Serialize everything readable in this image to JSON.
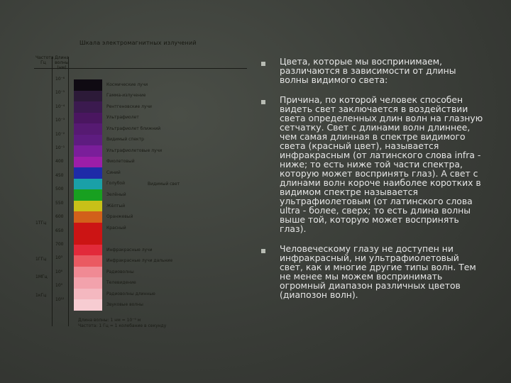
{
  "figure": {
    "title": "Шкала электромагнитных излучений",
    "head_a": "Частота Гц",
    "head_b": "Длина волны (нм)",
    "bands": [
      {
        "color": "#0f0a12",
        "label": "Космические лучи"
      },
      {
        "color": "#2c1a38",
        "label": "Гамма-излучение"
      },
      {
        "color": "#3b1a4f",
        "label": "Рентгеновские лучи"
      },
      {
        "color": "#4a1660",
        "label": "Ультрафиолет"
      },
      {
        "color": "#561a72",
        "label": "Ультрафиолет ближний"
      },
      {
        "color": "#5e1c80",
        "label": "Видимый спектр"
      },
      {
        "color": "#7a1e9a",
        "label": "Ультрафиолетовые лучи"
      },
      {
        "color": "#9c1ea8",
        "label": "Фиолетовый"
      },
      {
        "color": "#1e2ba8",
        "label": "Синий"
      },
      {
        "color": "#1aa0a8",
        "label": "Голубой"
      },
      {
        "color": "#18a020",
        "label": "Зелёный"
      },
      {
        "color": "#c8c018",
        "label": "Жёлтый"
      },
      {
        "color": "#d2601a",
        "label": "Оранжевый"
      },
      {
        "color": "#cc1414",
        "label": "Красный"
      },
      {
        "color": "#cc1414",
        "label": ""
      },
      {
        "color": "#e22a3a",
        "label": "Инфракрасные лучи"
      },
      {
        "color": "#ea5a62",
        "label": "Инфракрасные лучи дальние"
      },
      {
        "color": "#f08a94",
        "label": "Радиоволны"
      },
      {
        "color": "#f2a2ac",
        "label": "Телевидение"
      },
      {
        "color": "#f4b8c0",
        "label": "Радиоволны длинные"
      },
      {
        "color": "#f7ccd2",
        "label": "Звуковые волны"
      }
    ],
    "freq_labels": [
      "",
      "",
      "",
      "",
      "",
      "",
      "",
      "",
      "1ТГц",
      "",
      "1ГГц",
      "1МГц",
      "1кГц"
    ],
    "wl_labels": [
      "10⁻⁶",
      "10⁻⁵",
      "10⁻⁴",
      "10⁻³",
      "10⁻²",
      "10⁻¹",
      "400",
      "450",
      "500",
      "550",
      "600",
      "650",
      "700",
      "10³",
      "10⁶",
      "10⁹",
      "10¹²"
    ],
    "side_note": "Видимый свет",
    "bottom_note": "Длина волны: 1 нм = 10⁻⁹ м\nЧастота: 1 Гц = 1 колебание в секунду"
  },
  "bullets": [
    "Цвета, которые мы воспринимаем, различаются в зависимости от длины волны видимого света:",
    "Причина, по которой человек способен видеть свет заключается в воздействии света определенных длин волн на глазную сетчатку. Свет с длинами волн длиннее, чем самая длинная в спектре видимого света (красный цвет), называется инфракрасным (от латинского слова infra - ниже; то есть ниже той части спектра, которую может воспринять глаз). А свет с длинами волн короче наиболее коротких в видимом спектре называется ультрафиолетовым (от латинского слова ultra - более, сверх; то есть длина волны выше той, которую может воспринять глаз).",
    "Человеческому глазу не доступен ни инфракрасный, ни ультрафиолетовый свет, как и многие другие типы волн. Тем не менее мы можем воспринимать огромный диапазон различных цветов (диапозон волн)."
  ]
}
